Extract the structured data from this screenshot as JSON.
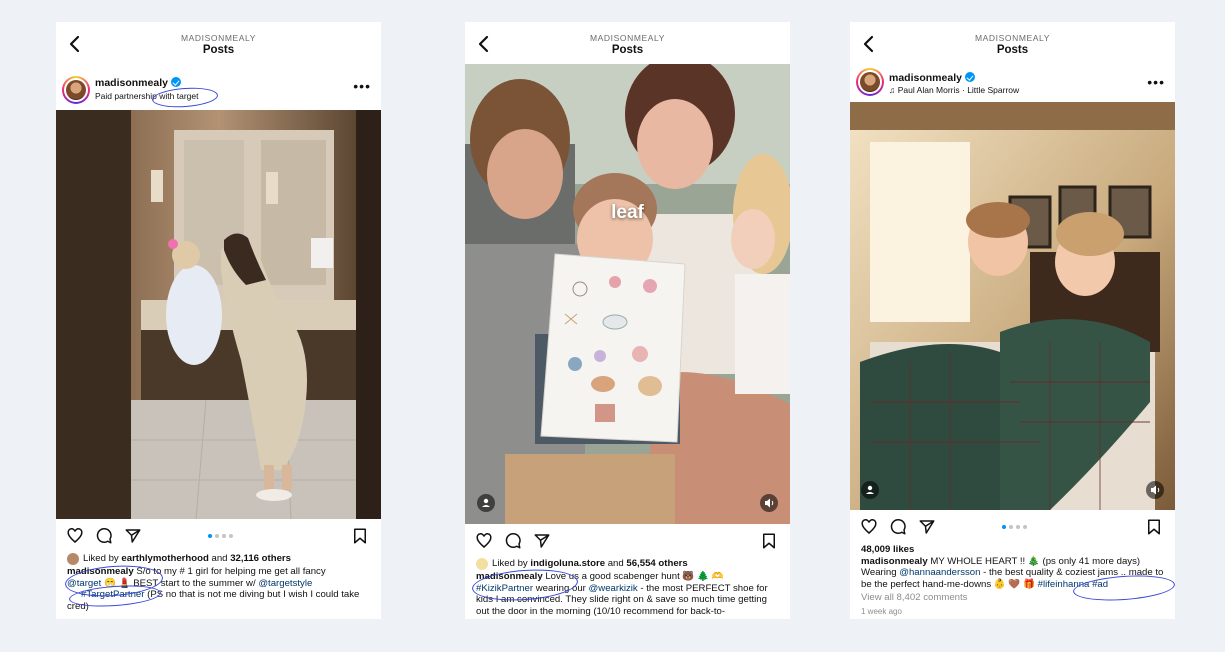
{
  "posts": [
    {
      "header": {
        "username": "MADISONMEALY",
        "title": "Posts"
      },
      "profile": {
        "name": "madisonmealy",
        "subtitle": "Paid partnership with target"
      },
      "likes": {
        "prefix": "Liked by",
        "user": "earthlymotherhood",
        "and": "and",
        "count": "32,116 others"
      },
      "caption": {
        "user": "madisonmealy",
        "text1": "S/o to my # 1 girl for helping me get all fancy",
        "tag1": "@target",
        "emojis": "😁 💄",
        "text2": "BEST start to the summer w/",
        "tag2": "@targetstyle",
        "tag3": "#TargetPartner",
        "text3": "(PS no that is not me diving but I wish I could take cred)"
      }
    },
    {
      "header": {
        "username": "MADISONMEALY",
        "title": "Posts"
      },
      "overlay_text": "leaf",
      "likes": {
        "prefix": "Liked by",
        "user": "indigoluna.store",
        "and": "and",
        "count": "56,554 others"
      },
      "caption": {
        "user": "madisonmealy",
        "text1": "Love us a good scabenger hunt 🐻 🌲 🫶",
        "tag1": "#KizikPartner",
        "text2": "wearing our",
        "tag2": "@wearkizik",
        "text3": "- the most PERFECT shoe for kids I am convinced. They slide right on & save so much time getting out the door in the morning (10/10 recommend for back-to-"
      }
    },
    {
      "header": {
        "username": "MADISONMEALY",
        "title": "Posts"
      },
      "profile": {
        "name": "madisonmealy",
        "subtitle": "Paul Alan Morris · Little Sparrow"
      },
      "likes_count": "48,009 likes",
      "caption": {
        "user": "madisonmealy",
        "text1": "MY WHOLE HEART !! 🎄 (ps only 41 more days)",
        "text2": "Wearing",
        "tag1": "@hannaandersson",
        "text3": "- the best quality & coziest jams .. made to be the perfect hand-me-downs 👶 🤎 🎁",
        "tag2": "#lifeinhanna",
        "tag3": "#ad"
      },
      "comments": "View all 8,402 comments",
      "time": "1 week ago"
    }
  ],
  "colors": {
    "verified": "#0095f6",
    "link": "#00376b",
    "annotation": "#3948d8",
    "background": "#eef1f6"
  },
  "icons": [
    "back-arrow-icon",
    "verified-badge-icon",
    "more-options-icon",
    "heart-icon",
    "comment-icon",
    "share-icon",
    "bookmark-icon",
    "user-tag-icon",
    "sound-icon",
    "music-note-icon"
  ]
}
